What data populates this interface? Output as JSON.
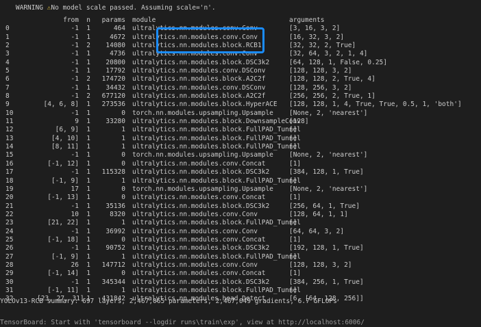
{
  "warning": {
    "prefix": "WARNING ",
    "icon": "warning-icon",
    "text": "No model scale passed. Assuming scale='n'."
  },
  "header": {
    "from": "from",
    "n": "n",
    "params": "params",
    "module": "module",
    "arguments": "arguments"
  },
  "rows": [
    {
      "idx": "0",
      "from": "-1",
      "n": "1",
      "params": "464",
      "module": "ultralytics.nn.modules.conv.Conv",
      "args": "[3, 16, 3, 2]"
    },
    {
      "idx": "1",
      "from": "-1",
      "n": "1",
      "params": "4672",
      "module": "ultralytics.nn.modules.conv.Conv",
      "args": "[16, 32, 3, 2]"
    },
    {
      "idx": "2",
      "from": "-1",
      "n": "2",
      "params": "14080",
      "module": "ultralytics.nn.modules.block.RCB1",
      "args": "[32, 32, 2, True]"
    },
    {
      "idx": "3",
      "from": "-1",
      "n": "1",
      "params": "4736",
      "module": "ultralytics.nn.modules.conv.Conv",
      "args": "[32, 64, 3, 2, 1, 4]"
    },
    {
      "idx": "4",
      "from": "-1",
      "n": "1",
      "params": "20800",
      "module": "ultralytics.nn.modules.block.DSC3k2",
      "args": "[64, 128, 1, False, 0.25]"
    },
    {
      "idx": "5",
      "from": "-1",
      "n": "1",
      "params": "17792",
      "module": "ultralytics.nn.modules.conv.DSConv",
      "args": "[128, 128, 3, 2]"
    },
    {
      "idx": "6",
      "from": "-1",
      "n": "2",
      "params": "174720",
      "module": "ultralytics.nn.modules.block.A2C2f",
      "args": "[128, 128, 2, True, 4]"
    },
    {
      "idx": "7",
      "from": "-1",
      "n": "1",
      "params": "34432",
      "module": "ultralytics.nn.modules.conv.DSConv",
      "args": "[128, 256, 3, 2]"
    },
    {
      "idx": "8",
      "from": "-1",
      "n": "2",
      "params": "677120",
      "module": "ultralytics.nn.modules.block.A2C2f",
      "args": "[256, 256, 2, True, 1]"
    },
    {
      "idx": "9",
      "from": "[4, 6, 8]",
      "n": "1",
      "params": "273536",
      "module": "ultralytics.nn.modules.block.HyperACE",
      "args": "[128, 128, 1, 4, True, True, 0.5, 1, 'both']"
    },
    {
      "idx": "10",
      "from": "-1",
      "n": "1",
      "params": "0",
      "module": "torch.nn.modules.upsampling.Upsample",
      "args": "[None, 2, 'nearest']"
    },
    {
      "idx": "11",
      "from": "9",
      "n": "1",
      "params": "33280",
      "module": "ultralytics.nn.modules.block.DownsampleConv",
      "args": "[128]"
    },
    {
      "idx": "12",
      "from": "[6, 9]",
      "n": "1",
      "params": "1",
      "module": "ultralytics.nn.modules.block.FullPAD_Tunnel",
      "args": "[]"
    },
    {
      "idx": "13",
      "from": "[4, 10]",
      "n": "1",
      "params": "1",
      "module": "ultralytics.nn.modules.block.FullPAD_Tunnel",
      "args": "[]"
    },
    {
      "idx": "14",
      "from": "[8, 11]",
      "n": "1",
      "params": "1",
      "module": "ultralytics.nn.modules.block.FullPAD_Tunnel",
      "args": "[]"
    },
    {
      "idx": "15",
      "from": "-1",
      "n": "1",
      "params": "0",
      "module": "torch.nn.modules.upsampling.Upsample",
      "args": "[None, 2, 'nearest']"
    },
    {
      "idx": "16",
      "from": "[-1, 12]",
      "n": "1",
      "params": "0",
      "module": "ultralytics.nn.modules.conv.Concat",
      "args": "[1]"
    },
    {
      "idx": "17",
      "from": "-1",
      "n": "1",
      "params": "115328",
      "module": "ultralytics.nn.modules.block.DSC3k2",
      "args": "[384, 128, 1, True]"
    },
    {
      "idx": "18",
      "from": "[-1, 9]",
      "n": "1",
      "params": "1",
      "module": "ultralytics.nn.modules.block.FullPAD_Tunnel",
      "args": "[]"
    },
    {
      "idx": "19",
      "from": "17",
      "n": "1",
      "params": "0",
      "module": "torch.nn.modules.upsampling.Upsample",
      "args": "[None, 2, 'nearest']"
    },
    {
      "idx": "20",
      "from": "[-1, 13]",
      "n": "1",
      "params": "0",
      "module": "ultralytics.nn.modules.conv.Concat",
      "args": "[1]"
    },
    {
      "idx": "21",
      "from": "-1",
      "n": "1",
      "params": "35136",
      "module": "ultralytics.nn.modules.block.DSC3k2",
      "args": "[256, 64, 1, True]"
    },
    {
      "idx": "22",
      "from": "10",
      "n": "1",
      "params": "8320",
      "module": "ultralytics.nn.modules.conv.Conv",
      "args": "[128, 64, 1, 1]"
    },
    {
      "idx": "23",
      "from": "[21, 22]",
      "n": "1",
      "params": "1",
      "module": "ultralytics.nn.modules.block.FullPAD_Tunnel",
      "args": "[]"
    },
    {
      "idx": "24",
      "from": "-1",
      "n": "1",
      "params": "36992",
      "module": "ultralytics.nn.modules.conv.Conv",
      "args": "[64, 64, 3, 2]"
    },
    {
      "idx": "25",
      "from": "[-1, 18]",
      "n": "1",
      "params": "0",
      "module": "ultralytics.nn.modules.conv.Concat",
      "args": "[1]"
    },
    {
      "idx": "26",
      "from": "-1",
      "n": "1",
      "params": "90752",
      "module": "ultralytics.nn.modules.block.DSC3k2",
      "args": "[192, 128, 1, True]"
    },
    {
      "idx": "27",
      "from": "[-1, 9]",
      "n": "1",
      "params": "1",
      "module": "ultralytics.nn.modules.block.FullPAD_Tunnel",
      "args": "[]"
    },
    {
      "idx": "28",
      "from": "26",
      "n": "1",
      "params": "147712",
      "module": "ultralytics.nn.modules.conv.Conv",
      "args": "[128, 128, 3, 2]"
    },
    {
      "idx": "29",
      "from": "[-1, 14]",
      "n": "1",
      "params": "0",
      "module": "ultralytics.nn.modules.conv.Concat",
      "args": "[1]"
    },
    {
      "idx": "30",
      "from": "-1",
      "n": "1",
      "params": "345344",
      "module": "ultralytics.nn.modules.block.DSC3k2",
      "args": "[384, 256, 1, True]"
    },
    {
      "idx": "31",
      "from": "[-1, 11]",
      "n": "1",
      "params": "1",
      "module": "ultralytics.nn.modules.block.FullPAD_Tunnel",
      "args": "[]"
    },
    {
      "idx": "32",
      "from": "[23, 27, 31]",
      "n": "1",
      "params": "431842",
      "module": "ultralytics.nn.modules.head.Detect",
      "args": "[6, [64, 128, 256]]"
    }
  ],
  "summary": "YOLOv13-RCB summary: 697 layers, 2,467,065 parameters, 2,467,049 gradients, 6.7 GFLOPs",
  "footer_cutoff": "TensorBoard: Start with 'tensorboard --logdir runs\\train\\exp', view at http://localhost:6006/",
  "colors": {
    "background": "#1e1e1e",
    "text": "#cccccc",
    "highlight_box": "#1a8cff",
    "warning_icon": "#e0c040"
  }
}
